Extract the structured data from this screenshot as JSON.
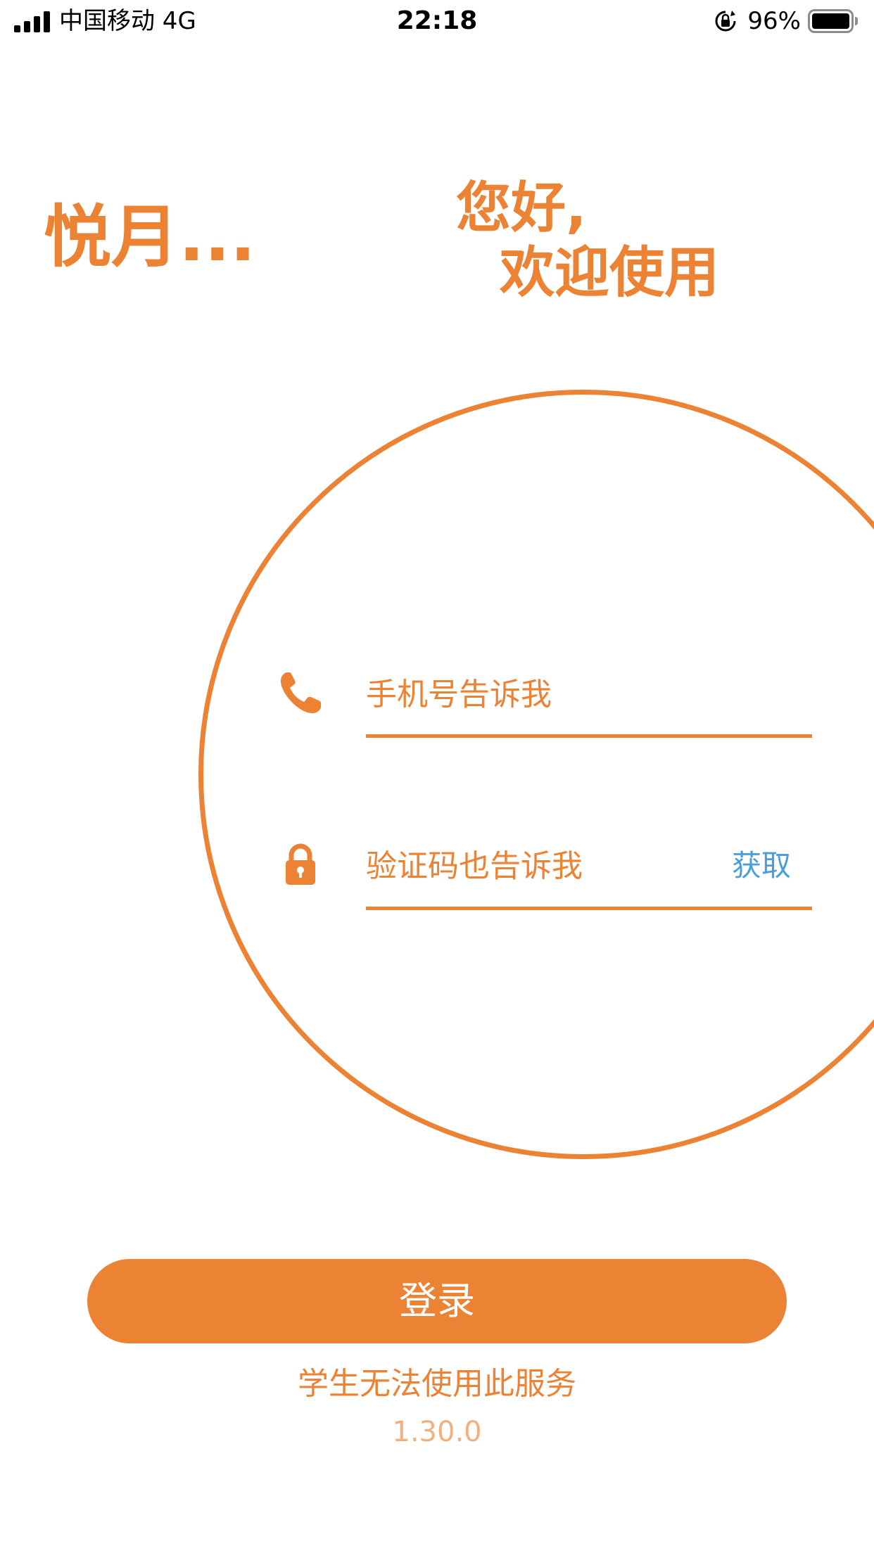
{
  "status_bar": {
    "carrier": "中国移动   4G",
    "time": "22:18",
    "battery_percent": "96%"
  },
  "header": {
    "brand": "悦月...",
    "greeting_line1": "您好,",
    "greeting_line2": "欢迎使用"
  },
  "form": {
    "phone_placeholder": "手机号告诉我",
    "code_placeholder": "验证码也告诉我",
    "get_code_label": "获取"
  },
  "login_button_label": "登录",
  "notice": "学生无法使用此服务",
  "version": "1.30.0",
  "icons": {
    "phone": "phone-icon",
    "lock": "lock-icon",
    "orientation_lock": "orientation-lock-icon",
    "battery": "battery-icon",
    "signal": "signal-icon"
  },
  "colors": {
    "accent": "#ec8233",
    "link": "#4a9fdb",
    "version_text": "#f1b07e",
    "background": "#ffffff"
  }
}
